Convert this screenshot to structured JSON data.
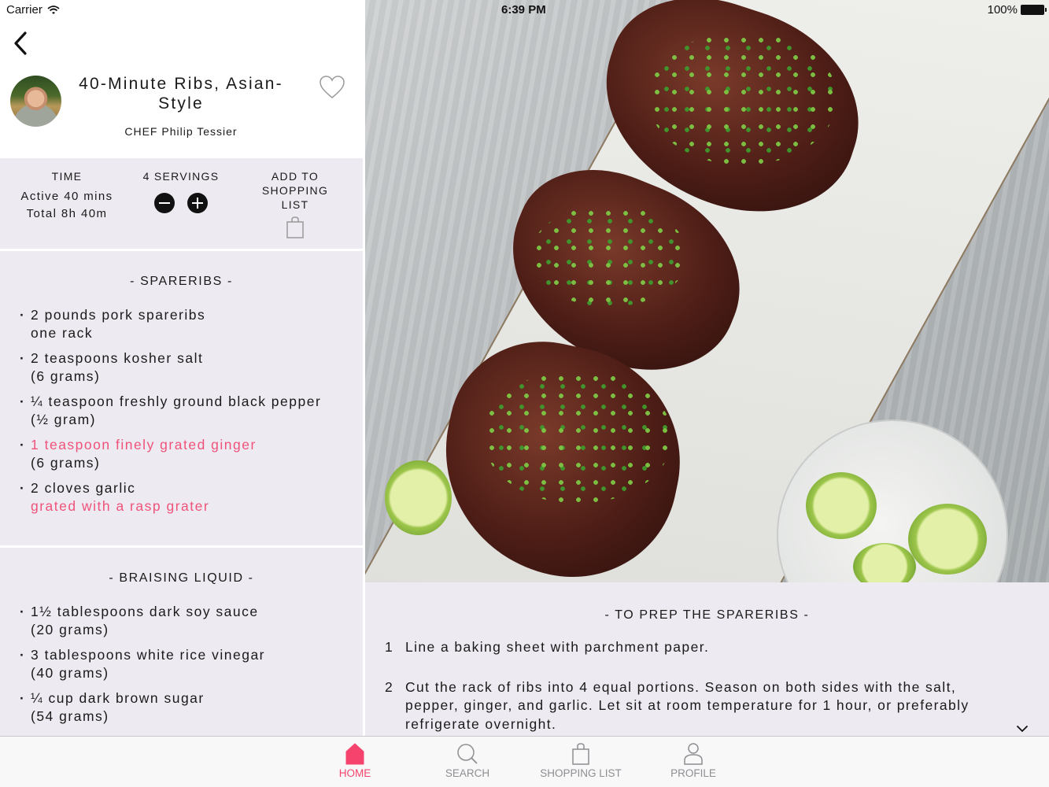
{
  "status_bar": {
    "carrier": "Carrier",
    "time": "6:39 PM",
    "battery": "100%"
  },
  "header": {
    "back_icon": "chevron-left-icon",
    "title": "40-Minute Ribs, Asian-Style",
    "chef_line": "CHEF Philip Tessier",
    "favorite_icon": "heart-outline-icon"
  },
  "info": {
    "time_label": "TIME",
    "active_time": "Active 40 mins",
    "total_time": "Total 8h 40m",
    "servings_label": "4 SERVINGS",
    "servings_count": 4,
    "decrease_icon": "minus-circle-icon",
    "increase_icon": "plus-circle-icon",
    "shopping_label": "ADD TO SHOPPING LIST",
    "shopping_icon": "shopping-bag-icon"
  },
  "ingredient_sections": [
    {
      "title": "- SPARERIBS -",
      "items": [
        {
          "main": "2 pounds pork spareribs",
          "note": "one rack",
          "highlight_main": false,
          "highlight_note": false
        },
        {
          "main": "2 teaspoons kosher salt",
          "note": "(6 grams)",
          "highlight_main": false,
          "highlight_note": false
        },
        {
          "main": "¼ teaspoon freshly ground black pepper",
          "note": "(½ gram)",
          "highlight_main": false,
          "highlight_note": false
        },
        {
          "main": "1 teaspoon finely grated ginger",
          "note": "(6 grams)",
          "highlight_main": true,
          "highlight_note": false
        },
        {
          "main": "2 cloves garlic",
          "note": "grated with a rasp grater",
          "highlight_main": false,
          "highlight_note": true
        }
      ]
    },
    {
      "title": "- BRAISING LIQUID -",
      "items": [
        {
          "main": "1½ tablespoons dark soy sauce",
          "note": "(20 grams)",
          "highlight_main": false,
          "highlight_note": false
        },
        {
          "main": "3 tablespoons white rice vinegar",
          "note": "(40 grams)",
          "highlight_main": false,
          "highlight_note": false
        },
        {
          "main": "¼ cup dark brown sugar",
          "note": "(54 grams)",
          "highlight_main": false,
          "highlight_note": false
        }
      ]
    }
  ],
  "photo": {
    "description": "Grilled Asian-style ribs with scallions and sesame on a white platter, lime halves on a small plate"
  },
  "steps": {
    "title": "- TO PREP THE SPARERIBS -",
    "items": [
      {
        "number": "1",
        "text": "Line a baking sheet with parchment paper."
      },
      {
        "number": "2",
        "text": "Cut the rack of ribs into 4 equal portions. Season on both sides with the salt, pepper, ginger, and garlic. Let sit at room temperature for 1 hour, or preferably refrigerate overnight."
      }
    ],
    "expand_icon": "chevron-down-icon"
  },
  "tab_bar": {
    "tabs": [
      {
        "label": "HOME",
        "icon": "home-icon",
        "active": true
      },
      {
        "label": "SEARCH",
        "icon": "search-icon",
        "active": false
      },
      {
        "label": "SHOPPING LIST",
        "icon": "shopping-bag-icon",
        "active": false
      },
      {
        "label": "PROFILE",
        "icon": "person-icon",
        "active": false
      }
    ]
  },
  "colors": {
    "accent": "#f5436d",
    "highlight_text": "#f0527a",
    "panel_bg": "#edebf1",
    "tab_inactive": "#8e8e93"
  }
}
